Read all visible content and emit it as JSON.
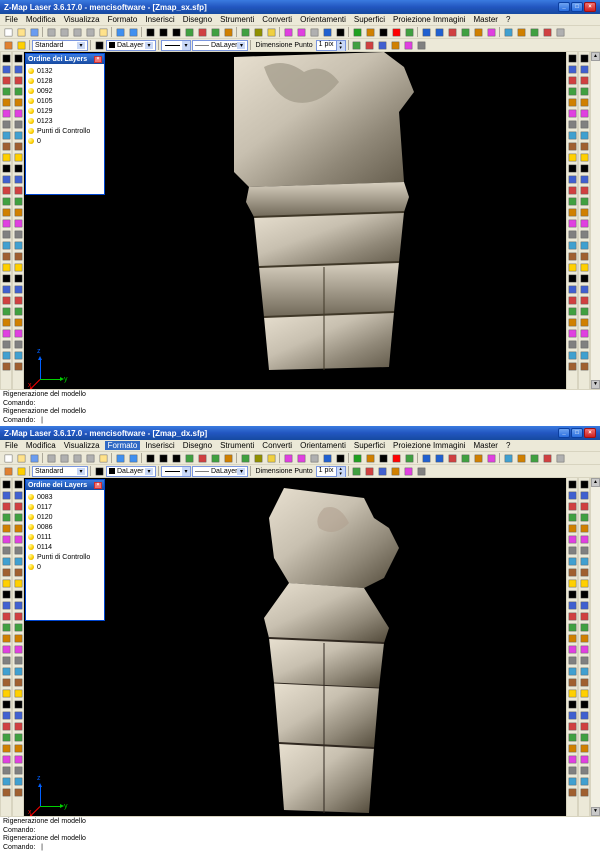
{
  "window1": {
    "title": "Z-Map Laser 3.6.17.0 - mencisoftware - [Zmap_sx.sfp]",
    "menu": [
      "File",
      "Modifica",
      "Visualizza",
      "Formato",
      "Inserisci",
      "Disegno",
      "Strumenti",
      "Converti",
      "Orientamenti",
      "Superfici",
      "Proiezione Immagini",
      "Master",
      "?"
    ],
    "menu_highlight_index": -1,
    "toolbar2": {
      "layer_combo": "Standard",
      "dalayer1": "DaLayer",
      "dalayer2": "DaLayer",
      "dim_label": "Dimensione Punto",
      "dim_value": "1 pix"
    },
    "layers": {
      "title": "Ordine dei Layers",
      "items": [
        "0132",
        "0128",
        "0092",
        "0105",
        "0129",
        "0123",
        "Punti di Controllo",
        "0"
      ]
    },
    "axis": {
      "x": "x",
      "y": "y",
      "z": "z"
    },
    "status": "Rigenerazione del modello\nComando:\nRigenerazione del modello\nComando:   |"
  },
  "window2": {
    "title": "Z-Map Laser 3.6.17.0 - mencisoftware - [Zmap_dx.sfp]",
    "menu": [
      "File",
      "Modifica",
      "Visualizza",
      "Formato",
      "Inserisci",
      "Disegno",
      "Strumenti",
      "Converti",
      "Orientamenti",
      "Superfici",
      "Proiezione Immagini",
      "Master",
      "?"
    ],
    "menu_highlight_index": 3,
    "toolbar2": {
      "layer_combo": "Standard",
      "dalayer1": "DaLayer",
      "dalayer2": "DaLayer",
      "dim_label": "Dimensione Punto",
      "dim_value": "1 pix"
    },
    "layers": {
      "title": "Ordine dei Layers",
      "items": [
        "0083",
        "0117",
        "0120",
        "0086",
        "0111",
        "0114",
        "Punti di Controllo",
        "0"
      ]
    },
    "axis": {
      "x": "x",
      "y": "y",
      "z": "z"
    },
    "status": "Rigenerazione del modello\nComando:\nRigenerazione del modello\nComando:   |"
  },
  "toolbar_icons_row1": [
    {
      "n": "new",
      "c": "#fff",
      "s": "#888"
    },
    {
      "n": "open",
      "c": "#ffe28a",
      "s": "#b08000"
    },
    {
      "n": "save",
      "c": "#6a9cf0",
      "s": "#2050b0"
    },
    {
      "n": "sep"
    },
    {
      "n": "clip",
      "c": "#b0b0b0"
    },
    {
      "n": "print",
      "c": "#b0b0b0"
    },
    {
      "n": "cut",
      "c": "#b0b0b0"
    },
    {
      "n": "copy",
      "c": "#b0b0b0"
    },
    {
      "n": "paste",
      "c": "#ffe28a"
    },
    {
      "n": "sep"
    },
    {
      "n": "undo",
      "c": "#4090f0"
    },
    {
      "n": "redo",
      "c": "#4090f0"
    },
    {
      "n": "sep"
    },
    {
      "n": "eye",
      "c": "#000"
    },
    {
      "n": "zoomw",
      "c": "#000"
    },
    {
      "n": "pan",
      "c": "#000"
    },
    {
      "n": "zoom+",
      "c": "#40a040"
    },
    {
      "n": "zoom-",
      "c": "#d04040"
    },
    {
      "n": "fit",
      "c": "#40a040"
    },
    {
      "n": "rot",
      "c": "#d08000"
    },
    {
      "n": "sep"
    },
    {
      "n": "orbit",
      "c": "#40a040"
    },
    {
      "n": "cam",
      "c": "#909000"
    },
    {
      "n": "light",
      "c": "#f0d040"
    },
    {
      "n": "sep"
    },
    {
      "n": "sel",
      "c": "#e040e0"
    },
    {
      "n": "grp",
      "c": "#e040e0"
    },
    {
      "n": "shade",
      "c": "#b0b0b0"
    },
    {
      "n": "wire",
      "c": "#2060d0"
    },
    {
      "n": "pnt",
      "c": "#000"
    },
    {
      "n": "sep"
    },
    {
      "n": "reg",
      "c": "#20a020"
    },
    {
      "n": "mesh",
      "c": "#d08000"
    },
    {
      "n": "pc",
      "c": "#000"
    },
    {
      "n": "col",
      "c": "#ff0000"
    },
    {
      "n": "tex",
      "c": "#40a040"
    },
    {
      "n": "sep"
    },
    {
      "n": "al1",
      "c": "#2060d0"
    },
    {
      "n": "al2",
      "c": "#2060d0"
    },
    {
      "n": "me",
      "c": "#d04040"
    },
    {
      "n": "sm",
      "c": "#40a040"
    },
    {
      "n": "de",
      "c": "#d08000"
    },
    {
      "n": "cl",
      "c": "#e040e0"
    },
    {
      "n": "sep"
    },
    {
      "n": "img",
      "c": "#40a0d0"
    },
    {
      "n": "prj",
      "c": "#d08000"
    },
    {
      "n": "ovr",
      "c": "#40a040"
    },
    {
      "n": "exp",
      "c": "#d04040"
    },
    {
      "n": "set",
      "c": "#b0b0b0"
    }
  ],
  "vtoolbar_left_icons": [
    "cursor",
    "hand",
    "sel-r",
    "sel-l",
    "sel-p",
    "line",
    "pline",
    "arc",
    "circle",
    "rect",
    "spline",
    "point",
    "text",
    "dim",
    "ang",
    "hatch",
    "erase",
    "move",
    "rot",
    "scale",
    "mirror",
    "offset",
    "trim",
    "ext",
    "fil",
    "chf",
    "break",
    "join",
    "layer"
  ],
  "vtoolbar_right_icons": [
    "v-front",
    "v-back",
    "v-left",
    "v-right",
    "v-top",
    "v-bot",
    "v-iso1",
    "v-iso2",
    "snap-e",
    "snap-m",
    "snap-c",
    "snap-i",
    "snap-p",
    "snap-t",
    "snap-n",
    "snap-q",
    "grid",
    "ortho",
    "osnap",
    "polar",
    "dyn",
    "lw",
    "model",
    "render",
    "wire",
    "hide",
    "shade",
    "ghost",
    "vp"
  ]
}
